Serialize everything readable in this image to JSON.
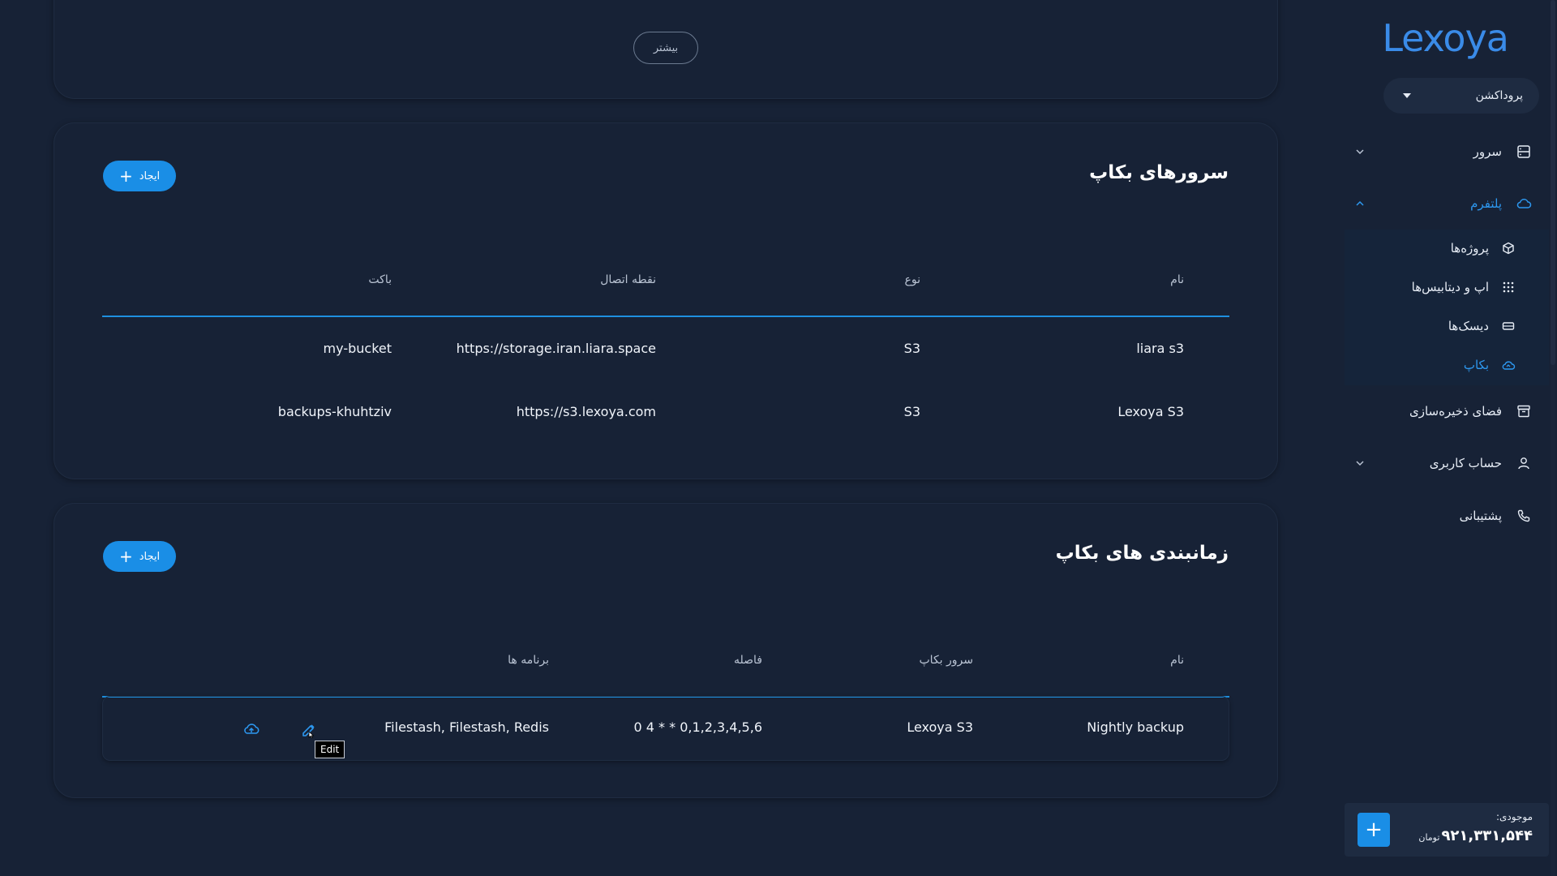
{
  "app": {
    "logo": "Lexoya"
  },
  "sidebar": {
    "environment": "پروداکشن",
    "items": [
      {
        "label": "سرور",
        "icon": "server-icon"
      },
      {
        "label": "پلتفرم",
        "icon": "cloud-icon"
      },
      {
        "label": "فضای ذخیره‌سازی",
        "icon": "archive-icon"
      },
      {
        "label": "حساب کاربری",
        "icon": "user-icon"
      },
      {
        "label": "پشتیبانی",
        "icon": "phone-icon"
      }
    ],
    "platform_sub": [
      {
        "label": "پروژه‌ها",
        "icon": "cube-icon"
      },
      {
        "label": "اپ و دیتابیس‌ها",
        "icon": "grid-icon"
      },
      {
        "label": "دیسک‌ها",
        "icon": "disk-icon"
      },
      {
        "label": "بکاپ",
        "icon": "cloud-upload-icon"
      }
    ],
    "balance": {
      "label": "موجودی:",
      "value": "۹۲۱,۳۳۱,۵۴۴",
      "currency": "تومان"
    }
  },
  "top_card": {
    "more_label": "بیشتر"
  },
  "backup_servers": {
    "title": "سرورهای بکاپ",
    "create_label": "ایجاد",
    "columns": {
      "name": "نام",
      "type": "نوع",
      "endpoint": "نقطه اتصال",
      "bucket": "باکت"
    },
    "rows": [
      {
        "name": "liara s3",
        "type": "S3",
        "endpoint": "https://storage.iran.liara.space",
        "bucket": "my-bucket"
      },
      {
        "name": "Lexoya S3",
        "type": "S3",
        "endpoint": "https://s3.lexoya.com",
        "bucket": "backups-khuhtziv"
      }
    ]
  },
  "backup_schedules": {
    "title": "زمانبندی های بکاپ",
    "create_label": "ایجاد",
    "columns": {
      "name": "نام",
      "server": "سرور بکاپ",
      "interval": "فاصله",
      "apps": "برنامه ها"
    },
    "rows": [
      {
        "name": "Nightly backup",
        "server": "Lexoya S3",
        "interval": "0 4 * * 0,1,2,3,4,5,6",
        "apps": "Filestash, Filestash, Redis"
      }
    ]
  },
  "tooltip": {
    "text": "Edit"
  },
  "colors": {
    "accent": "#1a8ee6",
    "background": "#172236",
    "active_text": "#2d98f0"
  }
}
